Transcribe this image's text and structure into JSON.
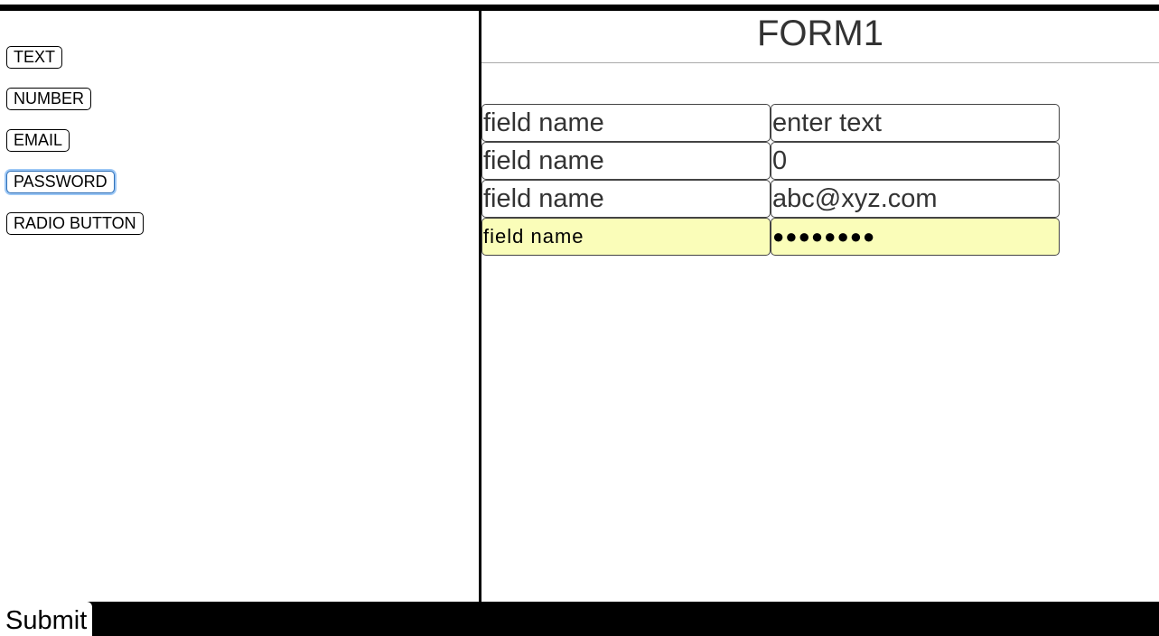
{
  "palette": {
    "items": [
      {
        "label": "TEXT"
      },
      {
        "label": "NUMBER"
      },
      {
        "label": "EMAIL"
      },
      {
        "label": "PASSWORD",
        "focused": true
      },
      {
        "label": "RADIO BUTTON"
      }
    ]
  },
  "form": {
    "title": "FORM1",
    "rows": [
      {
        "label": "field name",
        "value": "enter text",
        "type": "text"
      },
      {
        "label": "field name",
        "value": "0",
        "type": "text"
      },
      {
        "label": "field name",
        "value": "abc@xyz.com",
        "type": "text"
      },
      {
        "label": "field name",
        "value": "●●●●●●●●",
        "type": "password"
      }
    ]
  },
  "footer": {
    "submit_label": "Submit"
  },
  "colors": {
    "autofill_background": "#fafdb9",
    "focus_ring": "#9cc7f5",
    "bar": "#000000"
  }
}
